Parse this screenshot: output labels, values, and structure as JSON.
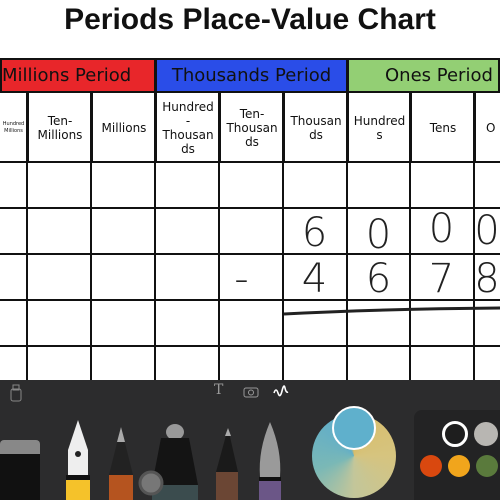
{
  "title": "Periods Place-Value Chart",
  "periods": [
    {
      "label": "Millions Period",
      "color": "#e8262a"
    },
    {
      "label": "Thousands Period",
      "color": "#2a4de8"
    },
    {
      "label": "Ones Period",
      "color": "#93cf74"
    }
  ],
  "columns": [
    "Hundred Millions",
    "Ten-Millions",
    "Millions",
    "Hundred-Thousands",
    "Ten-Thousands",
    "Thousands",
    "Hundreds",
    "Tens",
    "Ones"
  ],
  "columns_display": [
    "Hundred\nMillions",
    "Ten-\nMillions",
    "Millions",
    "Hundred\n-\nThousan\nds",
    "Ten-\nThousan\nds",
    "Thousan\nds",
    "Hundred\ns",
    "Tens",
    "O"
  ],
  "handwriting": {
    "row1": {
      "thousands": "6",
      "hundreds": "0",
      "tens": "0",
      "ones": "0"
    },
    "row2": {
      "sign": "-",
      "thousands": "4",
      "hundreds": "6",
      "tens": "7",
      "ones": "8"
    }
  },
  "toolbar": {
    "top_icons": [
      "lasso-icon",
      "text-icon",
      "camera-icon",
      "markup-icon"
    ],
    "tools": [
      "eraser",
      "fountain-pen",
      "pencil",
      "marker",
      "fineliner",
      "watercolor-brush"
    ],
    "selected_color": "#5fb0cc",
    "swatches": [
      "#1e1e1e",
      "#b8b6b2",
      "#d9480f",
      "#f1a51c",
      "#5a7a3c"
    ]
  }
}
